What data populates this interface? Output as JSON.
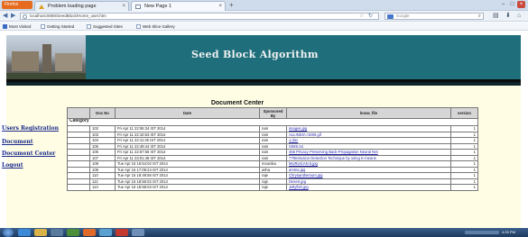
{
  "browser": {
    "firefox_label": "Firefox",
    "tabs": [
      {
        "label": "Problem loading page"
      },
      {
        "label": "New Page 1"
      }
    ],
    "url": "localhost:8080/SeedBlock/Home_user.htm",
    "search_placeholder": "Google",
    "bookmarks": [
      {
        "label": "Most Visited"
      },
      {
        "label": "Getting Started"
      },
      {
        "label": "Suggested Sites"
      },
      {
        "label": "Web Slice Gallery"
      }
    ]
  },
  "page": {
    "banner_title": "Seed Block Algorithm",
    "sidebar": [
      {
        "label": "Users Registration"
      },
      {
        "label": "Document"
      },
      {
        "label": "Document Center"
      },
      {
        "label": "Logout"
      }
    ],
    "doc_center": {
      "title": "Document Center",
      "columns": [
        "Doc No",
        "Date",
        "Sponsored By",
        "know_file",
        "version"
      ],
      "category_label": "Category",
      "rows": [
        {
          "doc_no": "102",
          "date": "Fri Apr 11 22:06:34 IST 2014",
          "by": "ram",
          "file": "images.jpg",
          "version": "1"
        },
        {
          "doc_no": "103",
          "date": "Fri Apr 11 22:10:53 IST 2014",
          "by": "ram",
          "file": "ALLINDIA r1000.gif",
          "version": "1"
        },
        {
          "doc_no": "104",
          "date": "Fri Apr 11 22:11:25 IST 2014",
          "by": "ram",
          "file": "1.doc",
          "version": "1"
        },
        {
          "doc_no": "105",
          "date": "Fri Apr 11 22:49:44 IST 2014",
          "by": "ram",
          "file": "SIMS.txt",
          "version": "1"
        },
        {
          "doc_no": "106",
          "date": "Fri Apr 11 22:57:56 IST 2014",
          "by": "ram",
          "file": "456 Privacy Preserving Back-Propagation Neural Net",
          "version": "1"
        },
        {
          "doc_no": "107",
          "date": "Fri Apr 11 23:01:48 IST 2014",
          "by": "ram",
          "file": "779Intrusion Detection Technique by using K-means",
          "version": "1"
        },
        {
          "doc_no": "108",
          "date": "Tue Apr 15 16:54:02 IST 2014",
          "by": "mounika",
          "file": "MURUGAN 5.jpg",
          "version": "1"
        },
        {
          "doc_no": "109",
          "date": "Tue Apr 15 17:09:24 IST 2014",
          "by": "asha",
          "file": "amma.jpg",
          "version": "1"
        },
        {
          "doc_no": "110",
          "date": "Tue Apr 15 18:49:56 IST 2014",
          "by": "raje",
          "file": "Chrysanthemum.jpg",
          "version": "1"
        },
        {
          "doc_no": "112",
          "date": "Tue Apr 15 18:56:02 IST 2014",
          "by": "raje",
          "file": "Desert.jpg",
          "version": "1"
        },
        {
          "doc_no": "113",
          "date": "Tue Apr 15 18:58:03 IST 2014",
          "by": "raje",
          "file": "Jellyfish.jpg",
          "version": "1"
        }
      ]
    }
  },
  "taskbar": {
    "clock": "4:25 PM"
  }
}
